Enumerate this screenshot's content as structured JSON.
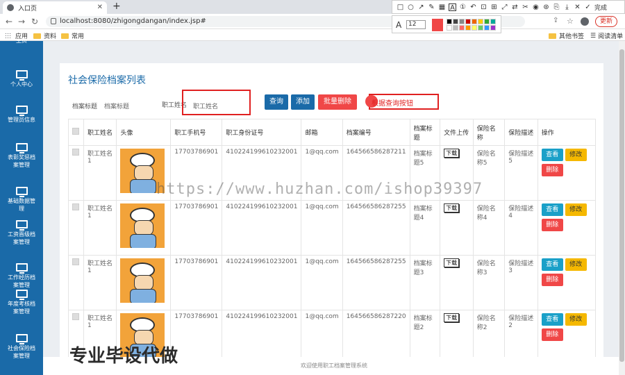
{
  "browser": {
    "tab_title": "入口页",
    "url": "localhost:8080/zhigongdangan/index.jsp#",
    "update_label": "更新",
    "bookmarks": [
      "应用",
      "资料",
      "常用"
    ],
    "bookmarks_right": [
      "其他书签",
      "阅读清单"
    ]
  },
  "snip_toolbar": {
    "done_label": "完成",
    "font_size": "12",
    "current_color": "#f04747"
  },
  "sidebar": {
    "items": [
      "主页",
      "个人中心",
      "管理员信息",
      "表彰奖惩档案管理",
      "基础数据管理",
      "工资晋级档案管理",
      "工作经历档案管理",
      "年度考核档案管理",
      "社会保险档案管理"
    ]
  },
  "page": {
    "title": "社会保险档案列表",
    "search": {
      "title_label": "档案标题",
      "title_placeholder": "档案标题",
      "name_label": "职工姓名",
      "name_placeholder": "职工姓名"
    },
    "buttons": {
      "query": "查询",
      "add": "添加",
      "batch_delete": "批量删除",
      "annotation": "根据查询按钮"
    },
    "columns": [
      "职工姓名",
      "头像",
      "职工手机号",
      "职工身份证号",
      "邮箱",
      "档案编号",
      "档案标题",
      "文件上传",
      "保险名称",
      "保险描述",
      "操作"
    ],
    "rows": [
      {
        "name": "职工姓名1",
        "phone": "17703786901",
        "id_card": "410224199610232001",
        "email": "1@qq.com",
        "doc_no": "164566586287211",
        "doc_title": "档案标题5",
        "ins_name": "保险名称5",
        "ins_desc": "保险描述5"
      },
      {
        "name": "职工姓名1",
        "phone": "17703786901",
        "id_card": "410224199610232001",
        "email": "1@qq.com",
        "doc_no": "164566586287255",
        "doc_title": "档案标题4",
        "ins_name": "保险名称4",
        "ins_desc": "保险描述4"
      },
      {
        "name": "职工姓名1",
        "phone": "17703786901",
        "id_card": "410224199610232001",
        "email": "1@qq.com",
        "doc_no": "164566586287255",
        "doc_title": "档案标题3",
        "ins_name": "保险名称3",
        "ins_desc": "保险描述3"
      },
      {
        "name": "职工姓名1",
        "phone": "17703786901",
        "id_card": "410224199610232001",
        "email": "1@qq.com",
        "doc_no": "164566586287220",
        "doc_title": "档案标题2",
        "ins_name": "保险名称2",
        "ins_desc": "保险描述2"
      }
    ],
    "row_actions": {
      "download": "下载",
      "view": "查看",
      "edit": "修改",
      "delete": "删除"
    },
    "footer": "欢迎使用职工档案管理系统"
  },
  "watermark": "https://www.huzhan.com/ishop39397",
  "watermark2": "专业毕设代做",
  "colors": {
    "sidebar": "#1a6aa8",
    "btn_primary": "#1a6aa8",
    "btn_danger": "#f04747",
    "btn_view": "#1aa0c8",
    "btn_edit": "#f5b800"
  }
}
